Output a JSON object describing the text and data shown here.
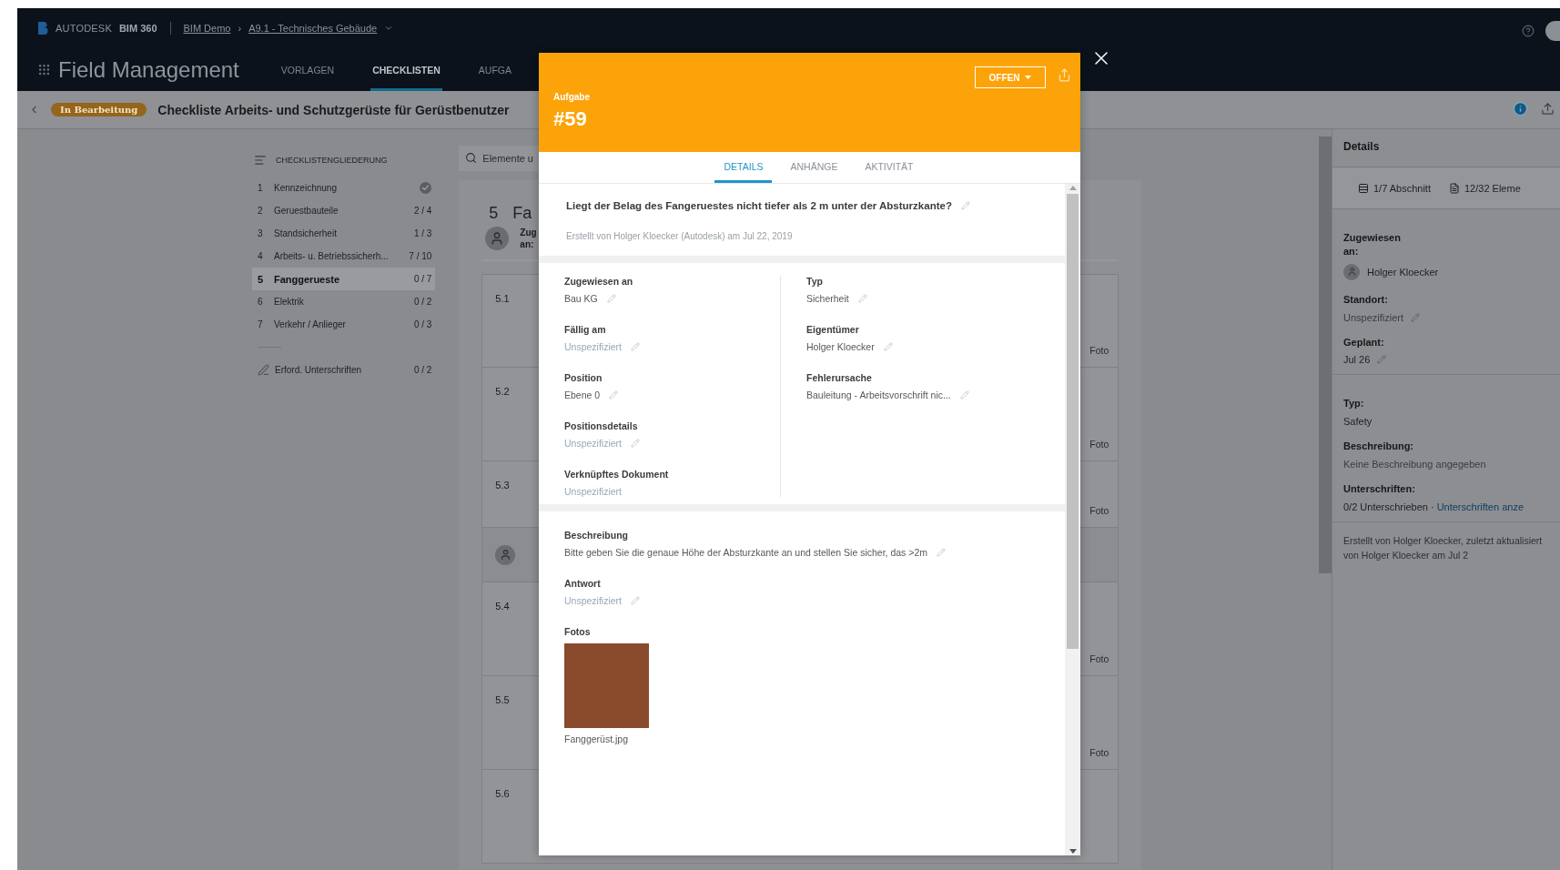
{
  "header": {
    "brand": "AUTODESK",
    "product": "BIM 360",
    "breadcrumb": [
      {
        "label": "BIM Demo"
      },
      {
        "label": "A9.1 - Technisches Gebäude"
      }
    ],
    "breadcrumb_separator": "›",
    "app_title": "Field Management",
    "nav_tabs": [
      {
        "label": "VORLAGEN",
        "selected": false
      },
      {
        "label": "CHECKLISTEN",
        "selected": true
      },
      {
        "label": "AUFGA",
        "selected": false
      }
    ]
  },
  "checklist_bar": {
    "status": "In Bearbeitung",
    "title": "Checkliste Arbeits- und Schutzgerüste für Gerüstbenutzer"
  },
  "outline": {
    "title": "CHECKLISTENGLIEDERUNG",
    "sections": [
      {
        "number": "1",
        "label": "Kennzeichnung",
        "complete": true,
        "selected": false
      },
      {
        "number": "2",
        "label": "Geruestbauteile",
        "count": "2 / 4",
        "complete": false,
        "selected": false
      },
      {
        "number": "3",
        "label": "Standsicherheit",
        "count": "1 / 3",
        "complete": false,
        "selected": false
      },
      {
        "number": "4",
        "label": "Arbeits- u. Betriebssicherh...",
        "count": "7 / 10",
        "complete": false,
        "selected": false
      },
      {
        "number": "5",
        "label": "Fanggerueste",
        "count": "0 / 7",
        "complete": false,
        "selected": true
      },
      {
        "number": "6",
        "label": "Elektrik",
        "count": "0 / 2",
        "complete": false,
        "selected": false
      },
      {
        "number": "7",
        "label": "Verkehr / Anlieger",
        "count": "0 / 3",
        "complete": false,
        "selected": false
      }
    ],
    "signatures": {
      "label": "Erford. Unterschriften",
      "count": "0 / 2"
    }
  },
  "section": {
    "search_placeholder": "Elemente u",
    "number": "5",
    "title": "Fa",
    "assignee_label": [
      "Zug",
      "an:"
    ],
    "items": [
      {
        "kind": "item",
        "number": "5.1",
        "attachment": "Foto"
      },
      {
        "kind": "item",
        "number": "5.2",
        "attachment": "Foto"
      },
      {
        "kind": "item",
        "number": "5.3",
        "attachment": "Foto"
      },
      {
        "kind": "assignee"
      },
      {
        "kind": "item",
        "number": "5.4",
        "attachment": "Foto"
      },
      {
        "kind": "item",
        "number": "5.5",
        "attachment": "Foto"
      },
      {
        "kind": "item",
        "number": "5.6"
      }
    ]
  },
  "task_modal": {
    "type_label": "Aufgabe",
    "number": "#59",
    "status": "OFFEN",
    "tabs": [
      {
        "label": "DETAILS",
        "selected": true
      },
      {
        "label": "ANHÄNGE",
        "selected": false
      },
      {
        "label": "AKTIVITÄT",
        "selected": false
      }
    ],
    "question": "Liegt der Belag des Fangeruestes nicht tiefer als 2 m unter der Absturzkante?",
    "created": "Erstellt von Holger Kloecker (Autodesk) am Jul 22, 2019",
    "fields_left": [
      {
        "label": "Zugewiesen an",
        "value": "Bau KG",
        "unspecified": false,
        "editable": true
      },
      {
        "label": "Fällig am",
        "value": "Unspezifiziert",
        "unspecified": true,
        "editable": true
      },
      {
        "label": "Position",
        "value": "Ebene 0",
        "unspecified": false,
        "editable": true
      },
      {
        "label": "Positionsdetails",
        "value": "Unspezifiziert",
        "unspecified": true,
        "editable": true
      },
      {
        "label": "Verknüpftes Dokument",
        "value": "Unspezifiziert",
        "unspecified": true,
        "editable": false
      }
    ],
    "fields_right": [
      {
        "label": "Typ",
        "value": "Sicherheit",
        "unspecified": false,
        "editable": true
      },
      {
        "label": "Eigentümer",
        "value": "Holger Kloecker",
        "unspecified": false,
        "editable": true
      },
      {
        "label": "Fehlerursache",
        "value": "Bauleitung - Arbeitsvorschrift nic...",
        "unspecified": false,
        "editable": true
      }
    ],
    "fields_bottom": [
      {
        "label": "Beschreibung",
        "value": "Bitte geben Sie die genaue Höhe der Absturzkante an und stellen Sie sicher, das >2m",
        "unspecified": false,
        "editable": true
      },
      {
        "label": "Antwort",
        "value": "Unspezifiziert",
        "unspecified": true,
        "editable": true
      }
    ],
    "photos": {
      "label": "Fotos",
      "items": [
        {
          "filename": "Fanggerüst.jpg"
        }
      ]
    }
  },
  "details_panel": {
    "title": "Details",
    "stats": [
      {
        "kind": "section",
        "text": "1/7 Abschnitt"
      },
      {
        "kind": "items",
        "text": "12/32 Eleme"
      }
    ],
    "assigned": {
      "label": "Zugewiesen an:",
      "name": "Holger Kloecker"
    },
    "fields": [
      {
        "label": "Standort:",
        "value": "Unspezifiziert",
        "unspecified": true,
        "editable": true
      },
      {
        "label": "Geplant:",
        "value": "Jul 26",
        "unspecified": false,
        "editable": true
      }
    ],
    "fields2": [
      {
        "label": "Typ:",
        "value": "Safety",
        "unspecified": false,
        "editable": false
      },
      {
        "label": "Beschreibung:",
        "value": "Keine Beschreibung angegeben",
        "unspecified": true,
        "editable": false
      }
    ],
    "signatures": {
      "label": "Unterschriften:",
      "status": "0/2 Unterschrieben",
      "separator": "·",
      "link": "Unterschriften anze"
    },
    "footer": "Erstellt von Holger Kloecker, zuletzt aktualisiert von Holger Kloecker am Jul 2"
  }
}
